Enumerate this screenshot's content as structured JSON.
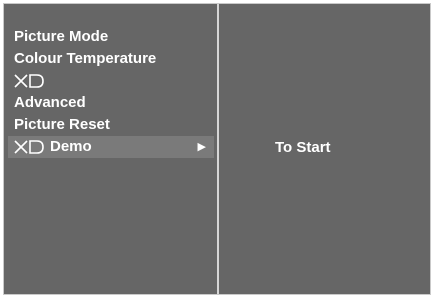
{
  "menu": {
    "items": [
      {
        "label": "Picture Mode"
      },
      {
        "label": "Colour Temperature"
      },
      {
        "label": "",
        "logo": "XD"
      },
      {
        "label": "Advanced"
      },
      {
        "label": "Picture Reset"
      },
      {
        "label": "Demo",
        "logo": "XD",
        "selected": true
      }
    ],
    "arrow_icon": "▶"
  },
  "submenu": {
    "items": [
      {
        "label": "To Start"
      }
    ]
  },
  "colors": {
    "panel_background": "#666666",
    "selected_background": "#7a7a7a",
    "text": "#ffffff"
  }
}
